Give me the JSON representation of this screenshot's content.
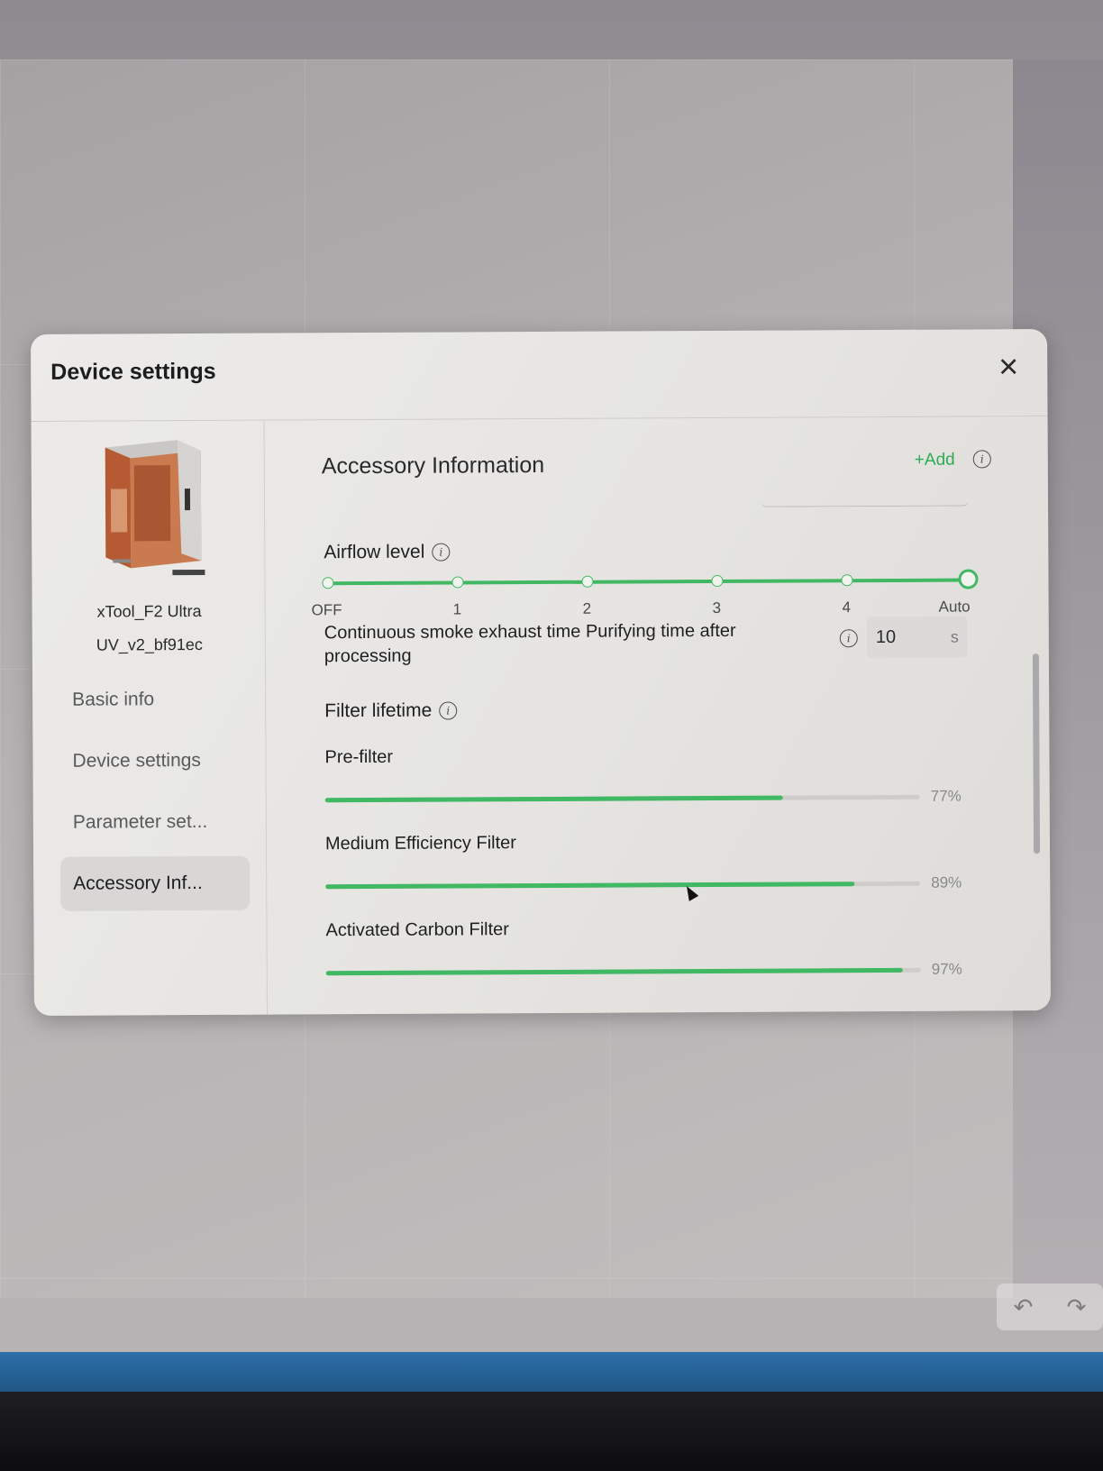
{
  "dialog": {
    "title": "Device settings",
    "close_icon": "close-icon"
  },
  "sidebar": {
    "device_name_line1": "xTool_F2 Ultra",
    "device_name_line2": "UV_v2_bf91ec",
    "items": [
      {
        "label": "Basic info",
        "active": false
      },
      {
        "label": "Device settings",
        "active": false
      },
      {
        "label": "Parameter set...",
        "active": false
      },
      {
        "label": "Accessory Inf...",
        "active": true
      }
    ]
  },
  "main": {
    "section_title": "Accessory Information",
    "add_label": "+Add",
    "airflow": {
      "label": "Airflow level",
      "ticks": [
        "OFF",
        "1",
        "2",
        "3",
        "4",
        "Auto"
      ],
      "selected": "Auto"
    },
    "exhaust": {
      "label": "Continuous smoke exhaust time Purifying time after processing",
      "value": "10",
      "unit": "s"
    },
    "filter_lifetime": {
      "label": "Filter lifetime",
      "filters": [
        {
          "name": "Pre-filter",
          "percent": 77,
          "percent_label": "77%"
        },
        {
          "name": "Medium Efficiency Filter",
          "percent": 89,
          "percent_label": "89%"
        },
        {
          "name": "Activated Carbon Filter",
          "percent": 97,
          "percent_label": "97%"
        }
      ]
    }
  },
  "colors": {
    "accent": "#43b864",
    "add_text": "#2eab52"
  },
  "icons": [
    "close-icon",
    "info-icon",
    "undo-icon",
    "redo-icon"
  ]
}
